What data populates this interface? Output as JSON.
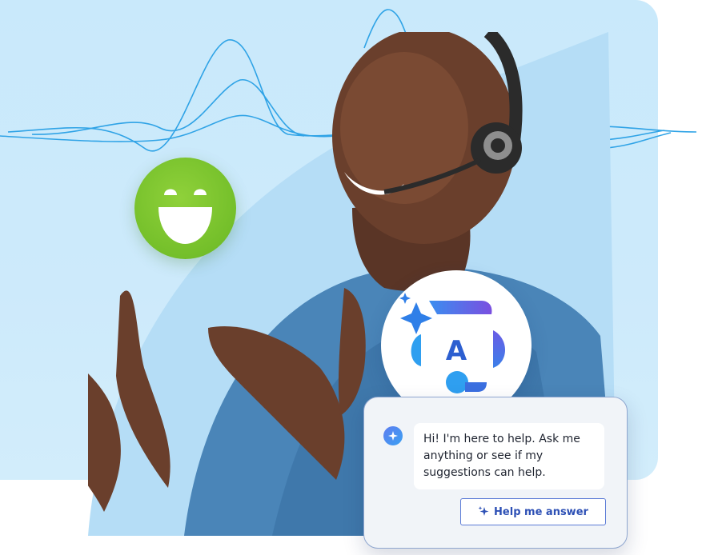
{
  "chat": {
    "message": "Hi! I'm here to help. Ask me anything or see if my suggestions can help.",
    "help_button_label": "Help me answer"
  },
  "icons": {
    "smiley": "smiley-face-icon",
    "ai_badge": "ai-assistant-logo-icon",
    "bot_avatar": "sparkle-icon",
    "button_icon": "sparkle-icon"
  },
  "colors": {
    "background": "#cdeafb",
    "smiley": "#74bf2a",
    "wave": "#2fa3e6",
    "button_text": "#2d50b5",
    "button_border": "#5b7bd6"
  }
}
